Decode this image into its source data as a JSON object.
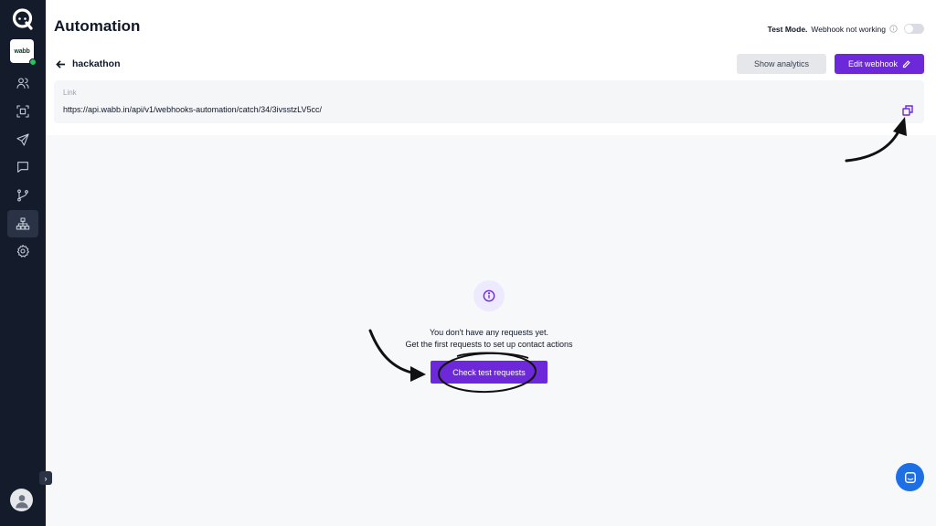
{
  "app": {
    "page_title": "Automation",
    "workspace_logo_text": "wabb"
  },
  "sidebar": {
    "items": [
      {
        "icon": "users-icon"
      },
      {
        "icon": "scan-icon"
      },
      {
        "icon": "send-icon"
      },
      {
        "icon": "message-icon"
      },
      {
        "icon": "git-branch-icon"
      },
      {
        "icon": "sitemap-icon",
        "active": true
      },
      {
        "icon": "settings-icon"
      }
    ],
    "expand_label": "›"
  },
  "header": {
    "test_mode_label": "Test Mode.",
    "webhook_status": "Webhook not working"
  },
  "webhook": {
    "name": "hackathon",
    "show_analytics_label": "Show analytics",
    "edit_label": "Edit webhook",
    "link_label": "Link",
    "link_url": "https://api.wabb.in/api/v1/webhooks-automation/catch/34/3ivsstzLV5cc/"
  },
  "empty_state": {
    "line1": "You don't have any requests yet.",
    "line2": "Get the first requests to set up contact actions",
    "button_label": "Check test requests"
  },
  "colors": {
    "sidebar_bg": "#141c2b",
    "accent": "#6d28d9",
    "chat_button": "#1d6fe6"
  }
}
